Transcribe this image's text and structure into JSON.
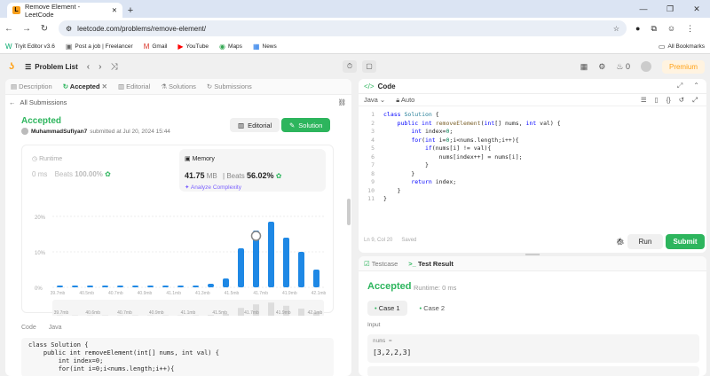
{
  "browser": {
    "tab_title": "Remove Element - LeetCode",
    "url": "leetcode.com/problems/remove-element/",
    "bookmarks": [
      "Tryit Editor v3.6",
      "Post a job | Freelancer",
      "Gmail",
      "YouTube",
      "Maps",
      "News"
    ],
    "all_bookmarks": "All Bookmarks"
  },
  "lc": {
    "problem_list": "Problem List",
    "premium": "Premium",
    "fire_count": "0"
  },
  "left": {
    "tabs": [
      "Description",
      "Accepted",
      "Editorial",
      "Solutions",
      "Submissions"
    ],
    "all_submissions": "All Submissions",
    "status": "Accepted",
    "user": "MuhammadSufiyan7",
    "submitted": "submitted at Jul 20, 2024 15:44",
    "editorial_btn": "Editorial",
    "solution_btn": "Solution",
    "runtime_label": "Runtime",
    "runtime_val": "0",
    "runtime_unit": "ms",
    "runtime_beats_label": "Beats",
    "runtime_beats": "100.00%",
    "memory_label": "Memory",
    "memory_val": "41.75",
    "memory_unit": "MB",
    "memory_beats_label": "Beats",
    "memory_beats": "56.02%",
    "analyze": "Analyze Complexity",
    "code_tab": "Code",
    "lang_tab": "Java",
    "code_preview": "class Solution {\n    public int removeElement(int[] nums, int val) {\n        int index=0;\n        for(int i=0;i<nums.length;i++){"
  },
  "chart_data": {
    "type": "bar",
    "categories": [
      "39.7mb",
      "",
      "40.5mb",
      "",
      "40.7mb",
      "",
      "40.9mb",
      "",
      "41.1mb",
      "",
      "41.3mb",
      "",
      "41.5mb",
      "",
      "41.7mb",
      "",
      "41.9mb",
      "",
      "42.1mb"
    ],
    "values": [
      0.5,
      0.5,
      0.5,
      0.5,
      0.5,
      0.5,
      0.5,
      0.5,
      0.5,
      0.5,
      1,
      2.5,
      11,
      16,
      18.5,
      14,
      10,
      5
    ],
    "yticks": [
      "20%",
      "10%",
      "0%"
    ],
    "ylim": [
      0,
      20
    ],
    "highlight_index": 13,
    "mini_labels": [
      "39.7mb",
      "40.6mb",
      "40.7mb",
      "40.9mb",
      "41.1mb",
      "41.5mb",
      "41.7mb",
      "41.9mb",
      "42.1mb"
    ]
  },
  "right": {
    "code_title": "Code",
    "lang": "Java",
    "auto": "Auto",
    "lines": [
      "1",
      "2",
      "3",
      "4",
      "5",
      "6",
      "7",
      "8",
      "9",
      "10",
      "11"
    ],
    "status_pos": "Ln 9, Col 20",
    "status_saved": "Saved",
    "run": "Run",
    "submit": "Submit",
    "bottom_tabs": [
      "Testcase",
      "Test Result"
    ],
    "result": "Accepted",
    "runtime": "Runtime: 0 ms",
    "cases": [
      "Case 1",
      "Case 2"
    ],
    "input_label": "Input",
    "input_key": "nums =",
    "input_val": "[3,2,2,3]"
  }
}
